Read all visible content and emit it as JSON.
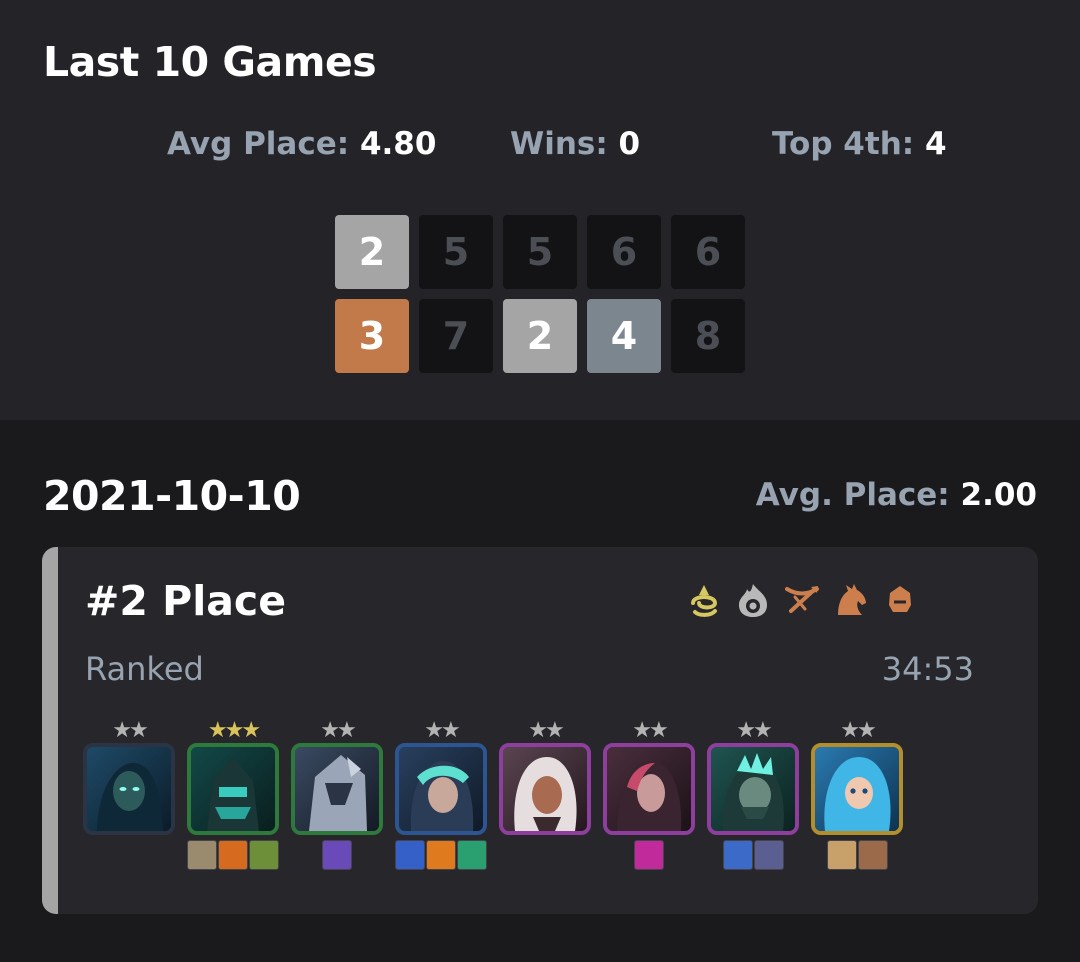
{
  "summary": {
    "title": "Last 10 Games",
    "avg_label": "Avg Place: ",
    "avg_value": "4.80",
    "wins_label": "Wins: ",
    "wins_value": "0",
    "top4_label": "Top 4th: ",
    "top4_value": "4",
    "placements": [
      "2",
      "5",
      "5",
      "6",
      "6",
      "3",
      "7",
      "2",
      "4",
      "8"
    ]
  },
  "day": {
    "date": "2021-10-10",
    "avg_label": "Avg. Place: ",
    "avg_value": "2.00"
  },
  "match": {
    "place": "#2 Place",
    "mode": "Ranked",
    "duration": "34:53",
    "trait_icons": [
      "spiral-trait-icon",
      "flame-eye-trait-icon",
      "crossbow-trait-icon",
      "horse-trait-icon",
      "helmet-trait-icon"
    ],
    "trait_colors": [
      "#d7c760",
      "#b8b8b8",
      "#cd7e4d",
      "#cd7e4d",
      "#cd7e4d"
    ],
    "units": [
      {
        "stars": "★★",
        "star_tier": "silver",
        "border": "#2b3444",
        "items": []
      },
      {
        "stars": "★★★",
        "star_tier": "gold",
        "border": "#2e7a3d",
        "items": [
          "#9a8a6e",
          "#d66a1e",
          "#6d8f3a"
        ]
      },
      {
        "stars": "★★",
        "star_tier": "silver",
        "border": "#2e7a3d",
        "items": [
          "#6a4ab8"
        ]
      },
      {
        "stars": "★★",
        "star_tier": "silver",
        "border": "#2c5592",
        "items": [
          "#3460c8",
          "#e07a1e",
          "#2aa070"
        ]
      },
      {
        "stars": "★★",
        "star_tier": "silver",
        "border": "#8e3f9e",
        "items": []
      },
      {
        "stars": "★★",
        "star_tier": "silver",
        "border": "#8e3f9e",
        "items": [
          "#c02a9a"
        ]
      },
      {
        "stars": "★★",
        "star_tier": "silver",
        "border": "#8e3f9e",
        "items": [
          "#3c6ac8",
          "#5a5e90"
        ]
      },
      {
        "stars": "★★",
        "star_tier": "silver",
        "border": "#b28e2c",
        "items": [
          "#c7a06a",
          "#9a6a4a"
        ]
      }
    ]
  }
}
